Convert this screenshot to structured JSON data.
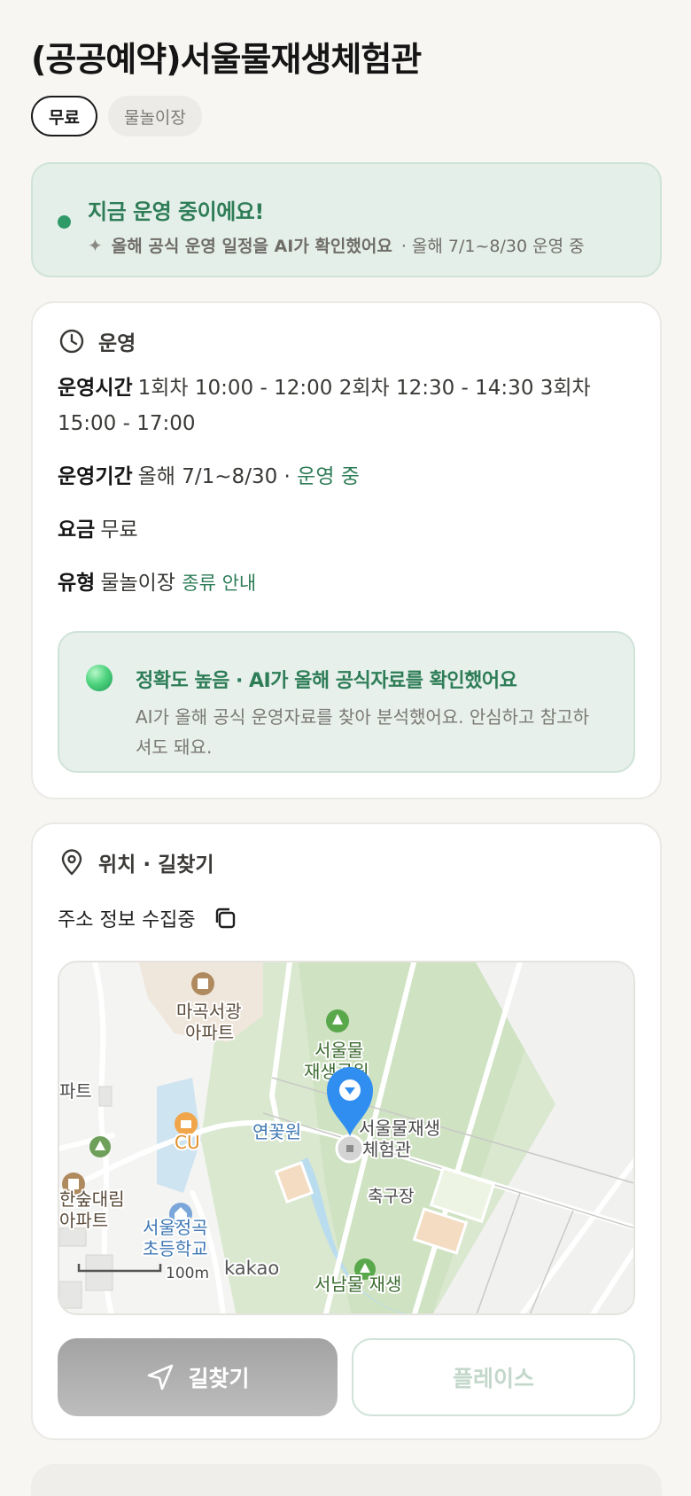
{
  "header": {
    "title": "(공공예약)서울물재생체험관",
    "chips": [
      {
        "label": "무료",
        "active": true
      },
      {
        "label": "물놀이장",
        "active": false
      }
    ]
  },
  "status": {
    "headline": "지금 운영 중이에요!",
    "ai_note": "올해 공식 운영 일정을 AI가 확인했어요",
    "period_note": "· 올해 7/1~8/30 운영 중",
    "dot_color": "#2f9a68"
  },
  "operation": {
    "section_title": "운영",
    "hours_label": "운영시간",
    "hours_value": "1회차 10:00 - 12:00 2회차 12:30 - 14:30 3회차 15:00 - 17:00",
    "period_label": "운영기간",
    "period_value": "올해 7/1~8/30 ·",
    "period_status": "운영 중",
    "fee_label": "요금",
    "fee_value": "무료",
    "type_label": "유형",
    "type_value": "물놀이장",
    "type_link": "종류 안내",
    "accuracy": {
      "title": "정확도 높음 · AI가 올해 공식자료를 확인했어요",
      "desc": "AI가 올해 공식 운영자료를 찾아 분석했어요. 안심하고 참고하셔도 돼요."
    }
  },
  "location": {
    "section_title": "위치 · 길찾기",
    "address": "주소 정보 수집중",
    "map": {
      "labels": {
        "apartment_top": "마곡서광",
        "apartment_top2": "아파트",
        "park": "서울물",
        "park2": "재생공원",
        "lotus": "연꽃원",
        "target": "서울물재생",
        "target2": "체험관",
        "soccer": "축구장",
        "cu": "CU",
        "left_apt": "파트",
        "hansup": "한숲대림",
        "hansup2": "아파트",
        "school": "서울정곡",
        "school2": "초등학교",
        "south_park": "서남물 재생",
        "scale": "100m",
        "brand": "kakao"
      },
      "pin_color": "#2f8ef0"
    },
    "nav_button": "길찾기",
    "place_button": "플레이스"
  }
}
